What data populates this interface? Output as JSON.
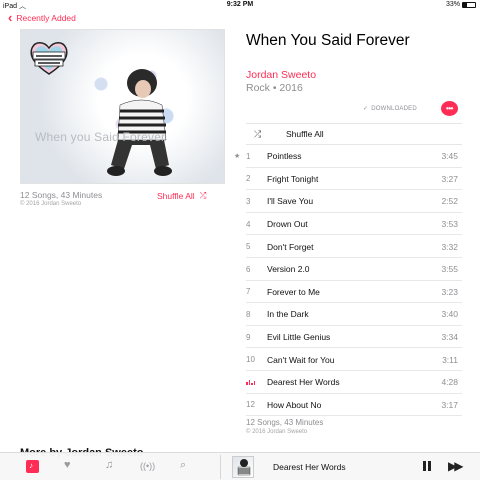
{
  "status_bar": {
    "device": "iPad",
    "time": "9:32 PM",
    "battery": "33%"
  },
  "nav": {
    "back_label": "Recently Added"
  },
  "artwork": {
    "watermark_text": "When you Said Forever"
  },
  "album": {
    "title": "When You Said Forever",
    "artist": "Jordan Sweeto",
    "genre_year": "Rock • 2016",
    "downloaded_label": "DOWNLOADED",
    "summary": "12 Songs, 43 Minutes",
    "copyright": "© 2016 Jordan Sweeto",
    "shuffle_all_label": "Shuffle All",
    "shuffle_row_label": "Shuffle All"
  },
  "tracks": [
    {
      "num": "1",
      "name": "Pointless",
      "duration": "3:45",
      "starred": true
    },
    {
      "num": "2",
      "name": "Fright Tonight",
      "duration": "3:27"
    },
    {
      "num": "3",
      "name": "I'll Save You",
      "duration": "2:52"
    },
    {
      "num": "4",
      "name": "Drown Out",
      "duration": "3:53"
    },
    {
      "num": "5",
      "name": "Don't Forget",
      "duration": "3:32"
    },
    {
      "num": "6",
      "name": "Version 2.0",
      "duration": "3:55"
    },
    {
      "num": "7",
      "name": "Forever to Me",
      "duration": "3:23"
    },
    {
      "num": "8",
      "name": "In the Dark",
      "duration": "3:40"
    },
    {
      "num": "9",
      "name": "Evil Little Genius",
      "duration": "3:34"
    },
    {
      "num": "10",
      "name": "Can't Wait for You",
      "duration": "3:11"
    },
    {
      "num": "",
      "name": "Dearest Her Words",
      "duration": "4:28",
      "playing": true
    },
    {
      "num": "12",
      "name": "How About No",
      "duration": "3:17"
    }
  ],
  "more_by": {
    "label": "More by Jordan Sweeto"
  },
  "mini_player": {
    "title": "Dearest Her Words"
  },
  "colors": {
    "accent": "#ff2d55",
    "secondary_text": "#8e8e93"
  },
  "icons": {
    "tabs": [
      "library-icon",
      "heart-icon",
      "music-note-icon",
      "radio-icon",
      "search-icon"
    ],
    "player": [
      "pause-icon",
      "fast-forward-icon"
    ]
  }
}
